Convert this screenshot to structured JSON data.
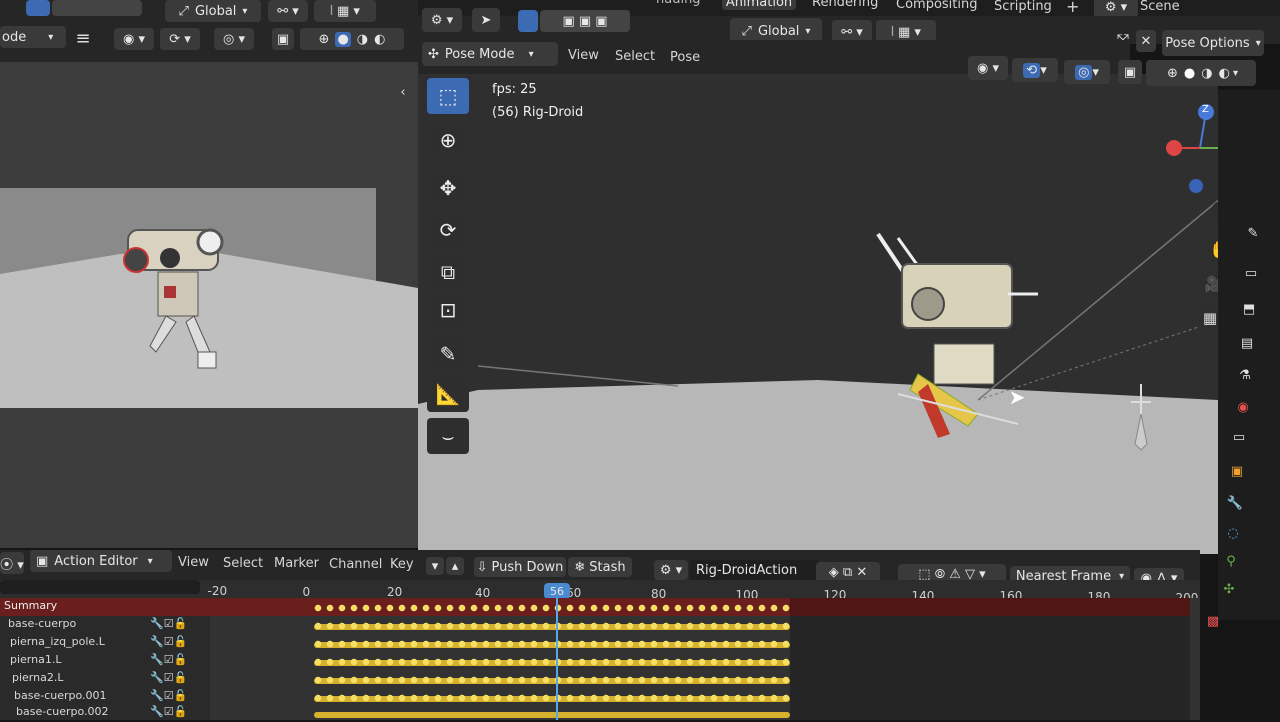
{
  "left_header": {
    "orientation_label": "Global",
    "mode_label": "ode"
  },
  "top_tabs": {
    "items": [
      "hading",
      "Animation",
      "Rendering",
      "Compositing",
      "Scripting"
    ],
    "add_label": "+",
    "scene_label": "Scene"
  },
  "viewport": {
    "mode_label": "Pose Mode",
    "menu": [
      "View",
      "Select",
      "Pose"
    ],
    "orientation_label": "Global",
    "options_label": "Pose Options",
    "fps_text": "fps: 25",
    "object_text": "(56) Rig-Droid",
    "gizmo_z": "Z"
  },
  "action_editor": {
    "editor_label": "Action Editor",
    "menu": [
      "View",
      "Select",
      "Marker",
      "Channel",
      "Key"
    ],
    "push_down_label": "Push Down",
    "stash_label": "Stash",
    "action_name": "Rig-DroidAction",
    "snap_label": "Nearest Frame",
    "current_frame": "56",
    "ticks": [
      "-20",
      "0",
      "20",
      "40",
      "60",
      "80",
      "100",
      "120",
      "140",
      "160",
      "180",
      "200"
    ],
    "channels": [
      "Summary",
      "base-cuerpo",
      "pierna_izq_pole.L",
      "pierna1.L",
      "pierna2.L",
      "base-cuerpo.001",
      "base-cuerpo.002"
    ]
  },
  "colors": {
    "accent": "#3d6bb3",
    "keyframe": "#f3df64",
    "summary_row": "#6b1e1e",
    "playhead": "#5aa7e8"
  }
}
